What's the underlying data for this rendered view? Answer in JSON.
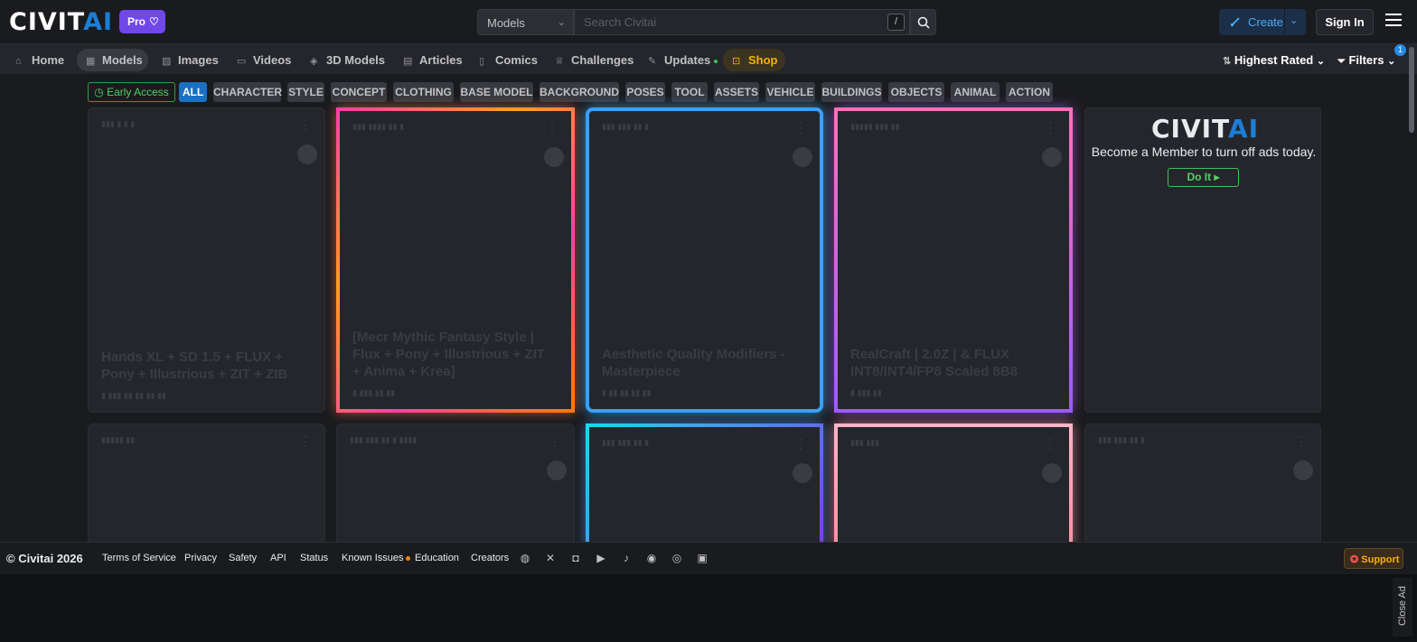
{
  "header": {
    "logo_part1": "CIVIT",
    "logo_part2": "AI",
    "pro_label": "Pro",
    "search_type": "Models",
    "search_placeholder": "Search Civitai",
    "search_shortcut": "/",
    "create_label": "Create",
    "signin_label": "Sign In"
  },
  "nav": {
    "items": [
      {
        "label": "Home",
        "icon": "home-icon"
      },
      {
        "label": "Models",
        "icon": "grid-icon"
      },
      {
        "label": "Images",
        "icon": "image-icon"
      },
      {
        "label": "Videos",
        "icon": "video-icon"
      },
      {
        "label": "3D Models",
        "icon": "cube-icon"
      },
      {
        "label": "Articles",
        "icon": "file-icon"
      },
      {
        "label": "Comics",
        "icon": "book-icon"
      },
      {
        "label": "Challenges",
        "icon": "trophy-icon"
      },
      {
        "label": "Updates",
        "icon": "sparkles-icon"
      },
      {
        "label": "Shop",
        "icon": "shopping-bag-icon"
      }
    ],
    "sort_label": "Highest Rated",
    "filters_label": "Filters",
    "filters_count": "1"
  },
  "chips": [
    "Early Access",
    "ALL",
    "CHARACTER",
    "STYLE",
    "CONCEPT",
    "CLOTHING",
    "BASE MODEL",
    "BACKGROUND",
    "POSES",
    "TOOL",
    "ASSETS",
    "VEHICLE",
    "BUILDINGS",
    "OBJECTS",
    "ANIMAL",
    "ACTION"
  ],
  "cards": [
    {
      "title": "Hands XL + SD 1.5 + FLUX + Pony + Illustrious + ZIT + ZIB"
    },
    {
      "title": "[Mecr Mythic Fantasy Style | Flux + Pony + Illustrious + ZIT + Anima + Krea]"
    },
    {
      "title": "Aesthetic Quality Modifiers - Masterpiece"
    },
    {
      "title": "RealCraft | 2.0Z | & FLUX INT8/INT4/FP8 Scaled 8B8"
    },
    {
      "title": ""
    },
    {
      "title": ""
    },
    {
      "title": ""
    },
    {
      "title": ""
    },
    {
      "title": ""
    }
  ],
  "ad": {
    "logo_part1": "CIVIT",
    "logo_part2": "AI",
    "text": "Become a Member to turn off ads today.",
    "button": "Do It"
  },
  "footer": {
    "copyright": "© Civitai 2026",
    "links": [
      "Terms of Service",
      "Privacy",
      "Safety",
      "API",
      "Status",
      "Known Issues",
      "Education",
      "Creators"
    ],
    "support_label": "Support",
    "close_ad_label": "Close Ad"
  },
  "colors": {
    "accent": "#1c7ed6",
    "pro": "#7048e8",
    "shop": "#fab005"
  }
}
